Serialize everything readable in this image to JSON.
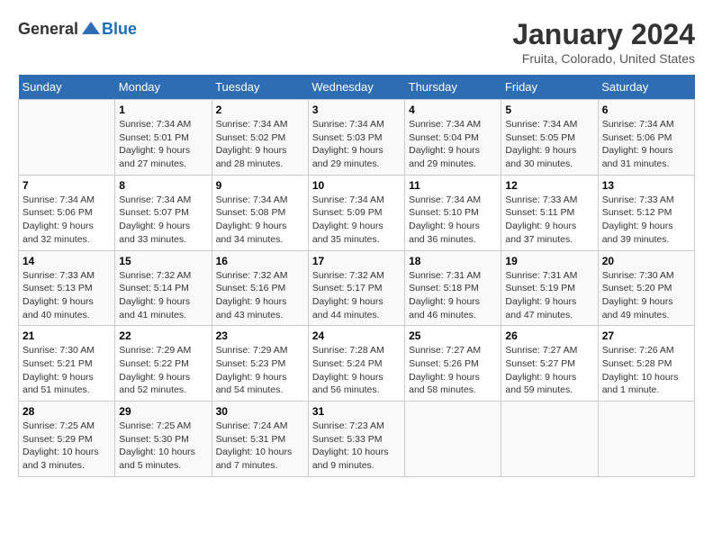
{
  "header": {
    "logo_general": "General",
    "logo_blue": "Blue",
    "title": "January 2024",
    "subtitle": "Fruita, Colorado, United States"
  },
  "days_of_week": [
    "Sunday",
    "Monday",
    "Tuesday",
    "Wednesday",
    "Thursday",
    "Friday",
    "Saturday"
  ],
  "weeks": [
    {
      "days": [
        {
          "num": "",
          "info": ""
        },
        {
          "num": "1",
          "info": "Sunrise: 7:34 AM\nSunset: 5:01 PM\nDaylight: 9 hours and 27 minutes."
        },
        {
          "num": "2",
          "info": "Sunrise: 7:34 AM\nSunset: 5:02 PM\nDaylight: 9 hours and 28 minutes."
        },
        {
          "num": "3",
          "info": "Sunrise: 7:34 AM\nSunset: 5:03 PM\nDaylight: 9 hours and 29 minutes."
        },
        {
          "num": "4",
          "info": "Sunrise: 7:34 AM\nSunset: 5:04 PM\nDaylight: 9 hours and 29 minutes."
        },
        {
          "num": "5",
          "info": "Sunrise: 7:34 AM\nSunset: 5:05 PM\nDaylight: 9 hours and 30 minutes."
        },
        {
          "num": "6",
          "info": "Sunrise: 7:34 AM\nSunset: 5:06 PM\nDaylight: 9 hours and 31 minutes."
        }
      ]
    },
    {
      "days": [
        {
          "num": "7",
          "info": "Sunrise: 7:34 AM\nSunset: 5:06 PM\nDaylight: 9 hours and 32 minutes."
        },
        {
          "num": "8",
          "info": "Sunrise: 7:34 AM\nSunset: 5:07 PM\nDaylight: 9 hours and 33 minutes."
        },
        {
          "num": "9",
          "info": "Sunrise: 7:34 AM\nSunset: 5:08 PM\nDaylight: 9 hours and 34 minutes."
        },
        {
          "num": "10",
          "info": "Sunrise: 7:34 AM\nSunset: 5:09 PM\nDaylight: 9 hours and 35 minutes."
        },
        {
          "num": "11",
          "info": "Sunrise: 7:34 AM\nSunset: 5:10 PM\nDaylight: 9 hours and 36 minutes."
        },
        {
          "num": "12",
          "info": "Sunrise: 7:33 AM\nSunset: 5:11 PM\nDaylight: 9 hours and 37 minutes."
        },
        {
          "num": "13",
          "info": "Sunrise: 7:33 AM\nSunset: 5:12 PM\nDaylight: 9 hours and 39 minutes."
        }
      ]
    },
    {
      "days": [
        {
          "num": "14",
          "info": "Sunrise: 7:33 AM\nSunset: 5:13 PM\nDaylight: 9 hours and 40 minutes."
        },
        {
          "num": "15",
          "info": "Sunrise: 7:32 AM\nSunset: 5:14 PM\nDaylight: 9 hours and 41 minutes."
        },
        {
          "num": "16",
          "info": "Sunrise: 7:32 AM\nSunset: 5:16 PM\nDaylight: 9 hours and 43 minutes."
        },
        {
          "num": "17",
          "info": "Sunrise: 7:32 AM\nSunset: 5:17 PM\nDaylight: 9 hours and 44 minutes."
        },
        {
          "num": "18",
          "info": "Sunrise: 7:31 AM\nSunset: 5:18 PM\nDaylight: 9 hours and 46 minutes."
        },
        {
          "num": "19",
          "info": "Sunrise: 7:31 AM\nSunset: 5:19 PM\nDaylight: 9 hours and 47 minutes."
        },
        {
          "num": "20",
          "info": "Sunrise: 7:30 AM\nSunset: 5:20 PM\nDaylight: 9 hours and 49 minutes."
        }
      ]
    },
    {
      "days": [
        {
          "num": "21",
          "info": "Sunrise: 7:30 AM\nSunset: 5:21 PM\nDaylight: 9 hours and 51 minutes."
        },
        {
          "num": "22",
          "info": "Sunrise: 7:29 AM\nSunset: 5:22 PM\nDaylight: 9 hours and 52 minutes."
        },
        {
          "num": "23",
          "info": "Sunrise: 7:29 AM\nSunset: 5:23 PM\nDaylight: 9 hours and 54 minutes."
        },
        {
          "num": "24",
          "info": "Sunrise: 7:28 AM\nSunset: 5:24 PM\nDaylight: 9 hours and 56 minutes."
        },
        {
          "num": "25",
          "info": "Sunrise: 7:27 AM\nSunset: 5:26 PM\nDaylight: 9 hours and 58 minutes."
        },
        {
          "num": "26",
          "info": "Sunrise: 7:27 AM\nSunset: 5:27 PM\nDaylight: 9 hours and 59 minutes."
        },
        {
          "num": "27",
          "info": "Sunrise: 7:26 AM\nSunset: 5:28 PM\nDaylight: 10 hours and 1 minute."
        }
      ]
    },
    {
      "days": [
        {
          "num": "28",
          "info": "Sunrise: 7:25 AM\nSunset: 5:29 PM\nDaylight: 10 hours and 3 minutes."
        },
        {
          "num": "29",
          "info": "Sunrise: 7:25 AM\nSunset: 5:30 PM\nDaylight: 10 hours and 5 minutes."
        },
        {
          "num": "30",
          "info": "Sunrise: 7:24 AM\nSunset: 5:31 PM\nDaylight: 10 hours and 7 minutes."
        },
        {
          "num": "31",
          "info": "Sunrise: 7:23 AM\nSunset: 5:33 PM\nDaylight: 10 hours and 9 minutes."
        },
        {
          "num": "",
          "info": ""
        },
        {
          "num": "",
          "info": ""
        },
        {
          "num": "",
          "info": ""
        }
      ]
    }
  ]
}
